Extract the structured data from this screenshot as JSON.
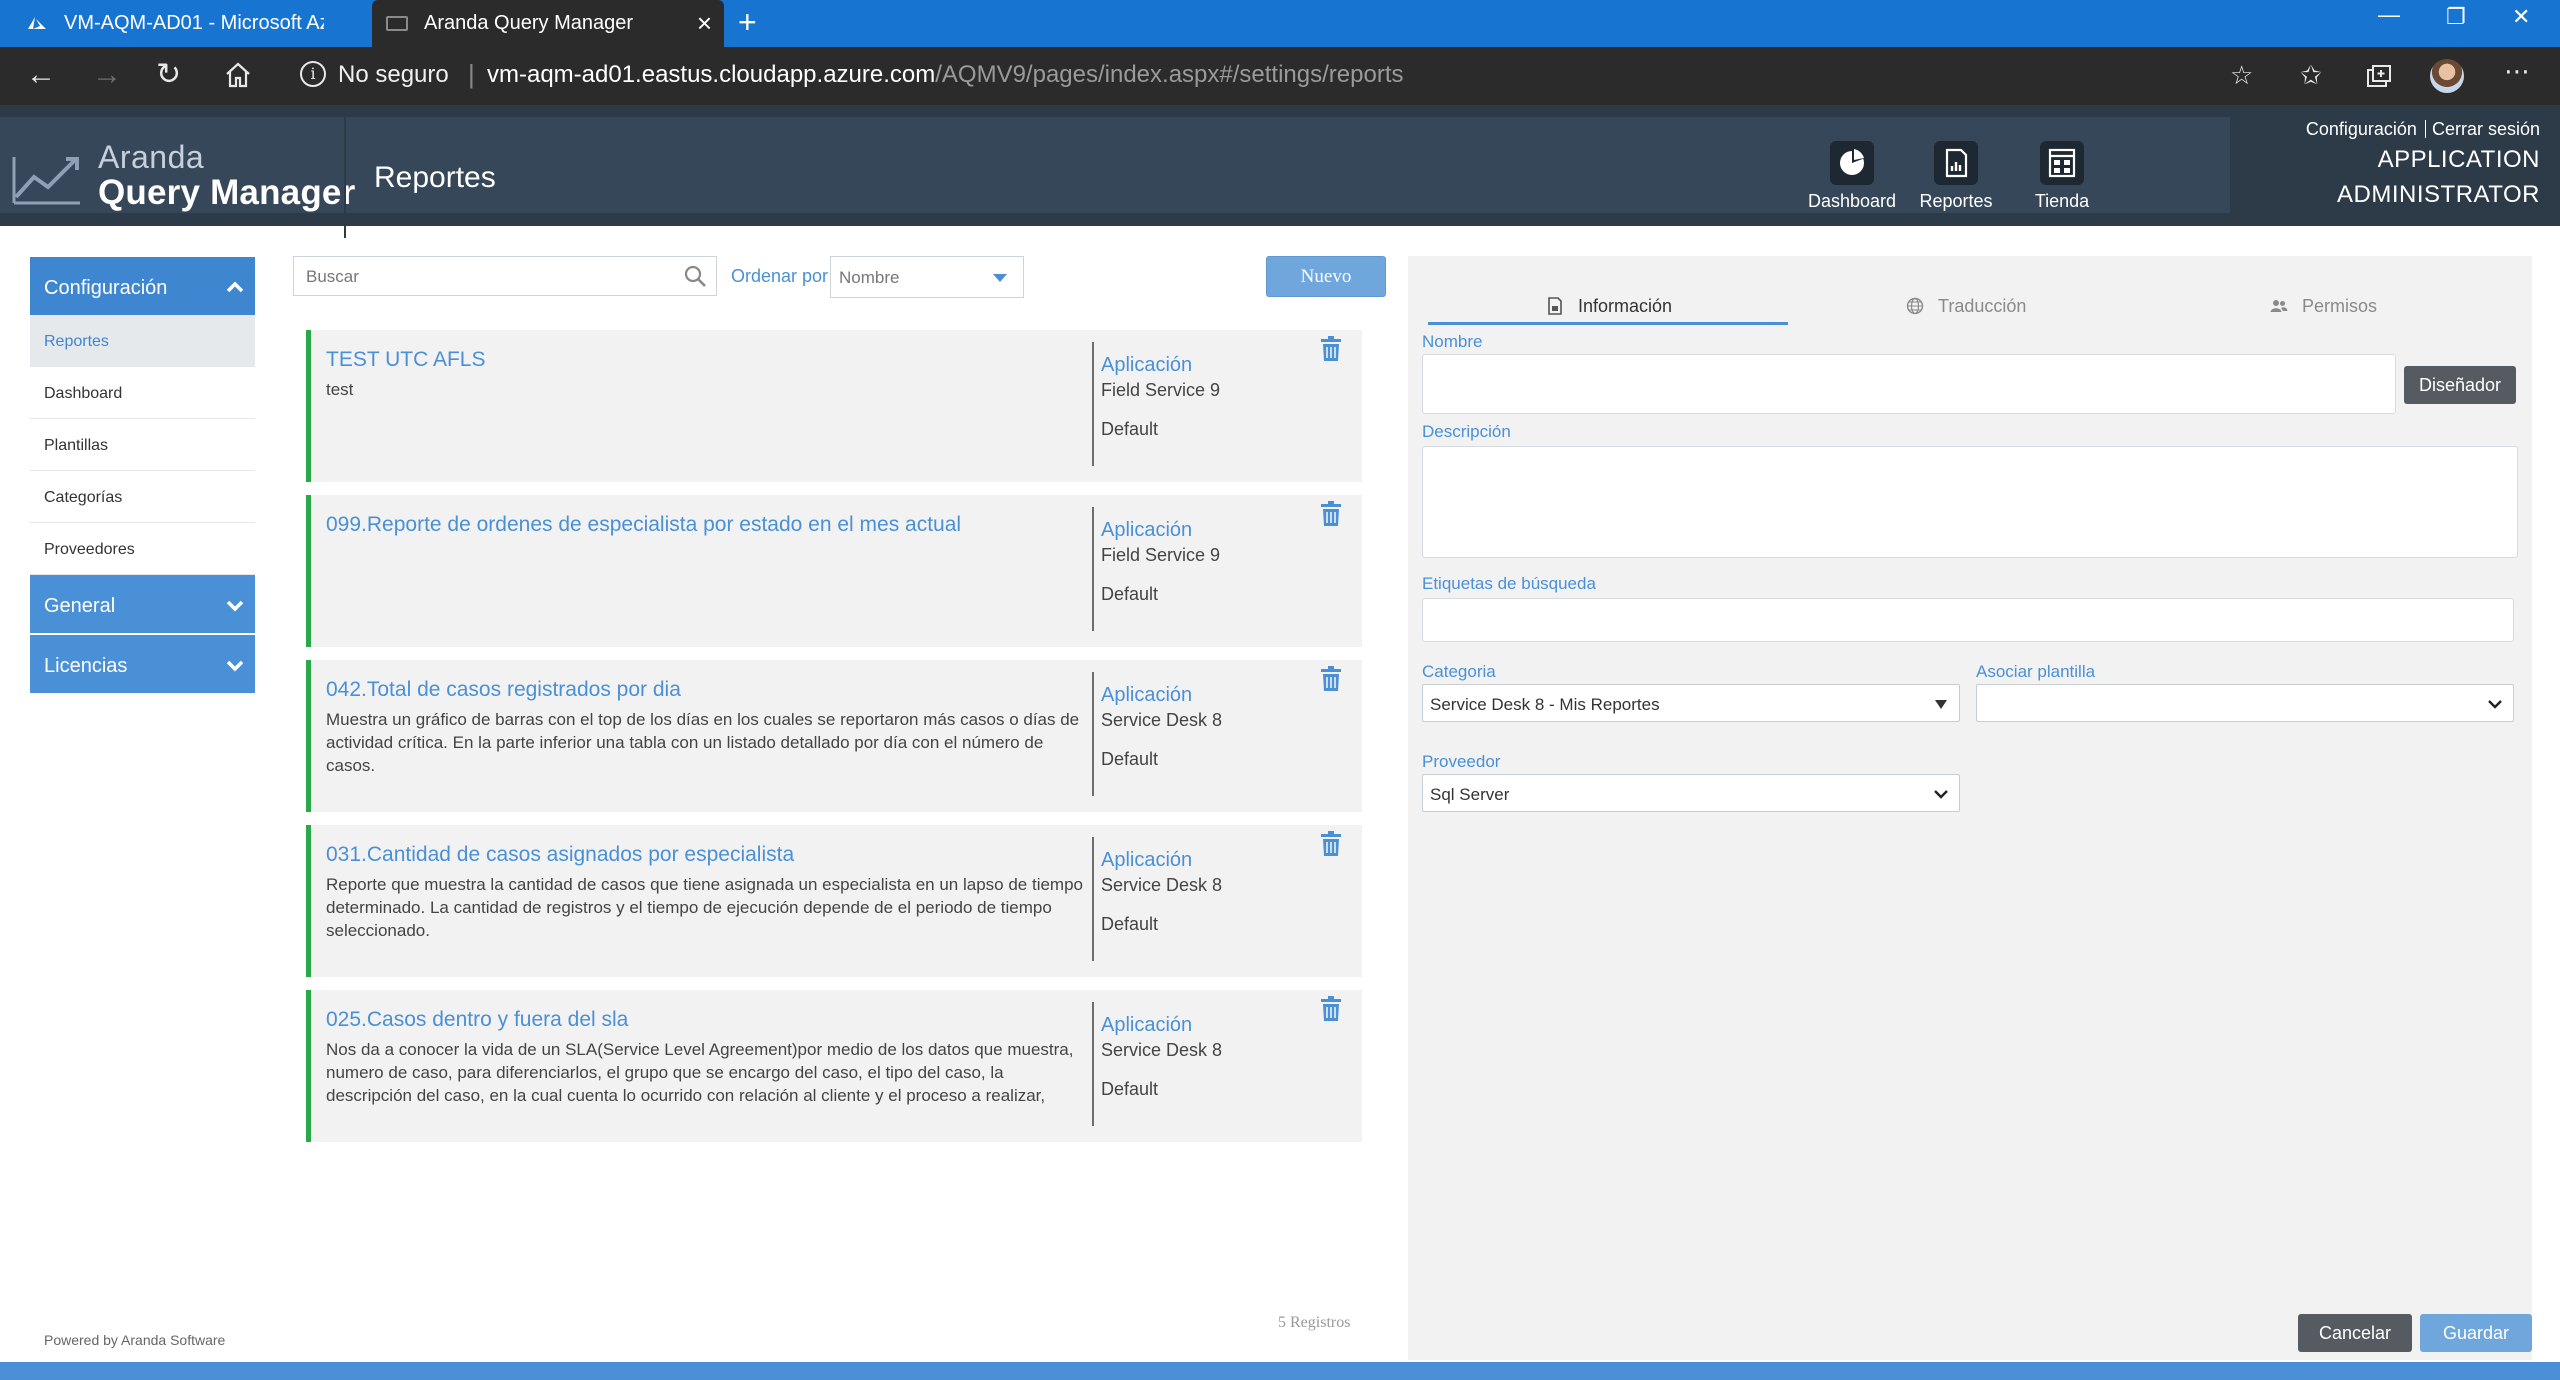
{
  "browser": {
    "tabs": [
      {
        "title": "VM-AQM-AD01 - Microsoft Azure"
      },
      {
        "title": "Aranda Query Manager"
      }
    ],
    "new_tab_symbol": "+",
    "address": {
      "security_label": "No seguro",
      "url_host": "vm-aqm-ad01.eastus.cloudapp.azure.com",
      "url_path": "/AQMV9/pages/index.aspx#/settings/reports"
    },
    "icons": [
      "back-icon",
      "forward-icon",
      "refresh-icon",
      "home-icon",
      "star-icon",
      "favorites-icon",
      "collections-icon",
      "profile-avatar",
      "more-icon"
    ]
  },
  "header": {
    "logo_top": "Aranda",
    "logo_bottom": "Query Manager",
    "page_title": "Reportes",
    "nav": [
      {
        "label": "Dashboard",
        "icon": "dashboard-pie-icon"
      },
      {
        "label": "Reportes",
        "icon": "reports-document-icon"
      },
      {
        "label": "Tienda",
        "icon": "store-icon"
      }
    ],
    "config_link": "Configuración",
    "logout_link": "Cerrar sesión",
    "user_line1": "APPLICATION",
    "user_line2": "ADMINISTRATOR"
  },
  "sidebar": {
    "sections": [
      {
        "label": "Configuración",
        "state": "expanded"
      },
      {
        "label": "General",
        "state": "collapsed"
      },
      {
        "label": "Licencias",
        "state": "collapsed"
      }
    ],
    "items": [
      {
        "label": "Reportes",
        "active": true
      },
      {
        "label": "Dashboard"
      },
      {
        "label": "Plantillas"
      },
      {
        "label": "Categorías"
      },
      {
        "label": "Proveedores"
      }
    ],
    "powered_by": "Powered by Aranda Software"
  },
  "list": {
    "search_placeholder": "Buscar",
    "order_label": "Ordenar por",
    "order_value": "Nombre",
    "new_button": "Nuevo",
    "count_label": "5 Registros",
    "reports": [
      {
        "title": "TEST UTC AFLS",
        "description": "test",
        "app_label": "Aplicación",
        "app": "Field Service 9",
        "provider": "Default"
      },
      {
        "title": "099.Reporte de ordenes de especialista por estado en el mes actual",
        "description": "",
        "app_label": "Aplicación",
        "app": "Field Service 9",
        "provider": "Default"
      },
      {
        "title": "042.Total de casos registrados por dia",
        "description": "Muestra un gráfico de barras con el top de los días en los cuales se reportaron más casos o días de actividad crítica. En la parte inferior una tabla con un listado detallado por día con el número de casos.",
        "app_label": "Aplicación",
        "app": "Service Desk 8",
        "provider": "Default"
      },
      {
        "title": "031.Cantidad de casos asignados por especialista",
        "description": "Reporte que muestra la cantidad de casos que tiene asignada un especialista en un lapso de tiempo determinado. La cantidad de registros y el tiempo de ejecución depende de el periodo de tiempo seleccionado.",
        "app_label": "Aplicación",
        "app": "Service Desk 8",
        "provider": "Default"
      },
      {
        "title": "025.Casos dentro y fuera del sla",
        "description": "Nos da a conocer la vida de un SLA(Service Level Agreement)por medio de los datos que muestra, numero de caso, para diferenciarlos, el grupo que se encargo del caso, el tipo del caso, la descripción del caso, en la cual cuenta lo ocurrido con relación al cliente y el proceso a realizar,",
        "app_label": "Aplicación",
        "app": "Service Desk 8",
        "provider": "Default"
      }
    ]
  },
  "detail": {
    "tabs": [
      {
        "label": "Información",
        "active": true
      },
      {
        "label": "Traducción"
      },
      {
        "label": "Permisos"
      }
    ],
    "fields": {
      "nombre_label": "Nombre",
      "nombre_value": "",
      "designer_button": "Diseñador",
      "descripcion_label": "Descripción",
      "descripcion_value": "",
      "etiquetas_label": "Etiquetas de búsqueda",
      "etiquetas_value": "",
      "categoria_label": "Categoria",
      "categoria_value": "Service Desk 8 - Mis Reportes",
      "plantilla_label": "Asociar plantilla",
      "plantilla_value": "",
      "proveedor_label": "Proveedor",
      "proveedor_value": "Sql Server"
    },
    "cancel_button": "Cancelar",
    "save_button": "Guardar"
  },
  "colors": {
    "accent": "#4a90d6",
    "header_bg": "#37475a",
    "success_border": "#2aa84a",
    "browser_tabbar": "#1874d1"
  }
}
